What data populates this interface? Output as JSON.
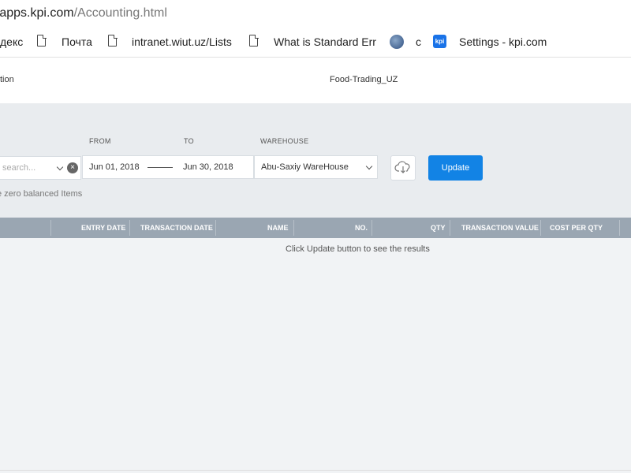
{
  "browser": {
    "url_prefix": "://",
    "url_host": "apps.kpi.com",
    "url_path": "/Accounting.html"
  },
  "bookmarks": {
    "items": [
      "декс",
      "Почта",
      "intranet.wiut.uz/Lists",
      "What is Standard Err",
      "с",
      "Settings - kpi.com"
    ],
    "kpi_icon_text": "kpi"
  },
  "header": {
    "left_title": "tion",
    "company": "Food-Trading_UZ"
  },
  "filters": {
    "from_label": "FROM",
    "to_label": "TO",
    "warehouse_label": "WAREHOUSE",
    "search_placeholder": "search...",
    "clear_symbol": "×",
    "from_date": "Jun 01, 2018",
    "to_date": "Jun 30, 2018",
    "warehouse": "Abu-Saxiy WareHouse",
    "update_label": "Update",
    "zero_balanced": "e zero balanced Items"
  },
  "table": {
    "columns": [
      "ENTRY DATE",
      "TRANSACTION DATE",
      "NAME",
      "NO.",
      "QTY",
      "TRANSACTION VALUE",
      "COST PER QTY"
    ],
    "empty_message": "Click Update button to see the results"
  },
  "colors": {
    "accent": "#1283e5",
    "table_header": "#9aa6b2"
  }
}
